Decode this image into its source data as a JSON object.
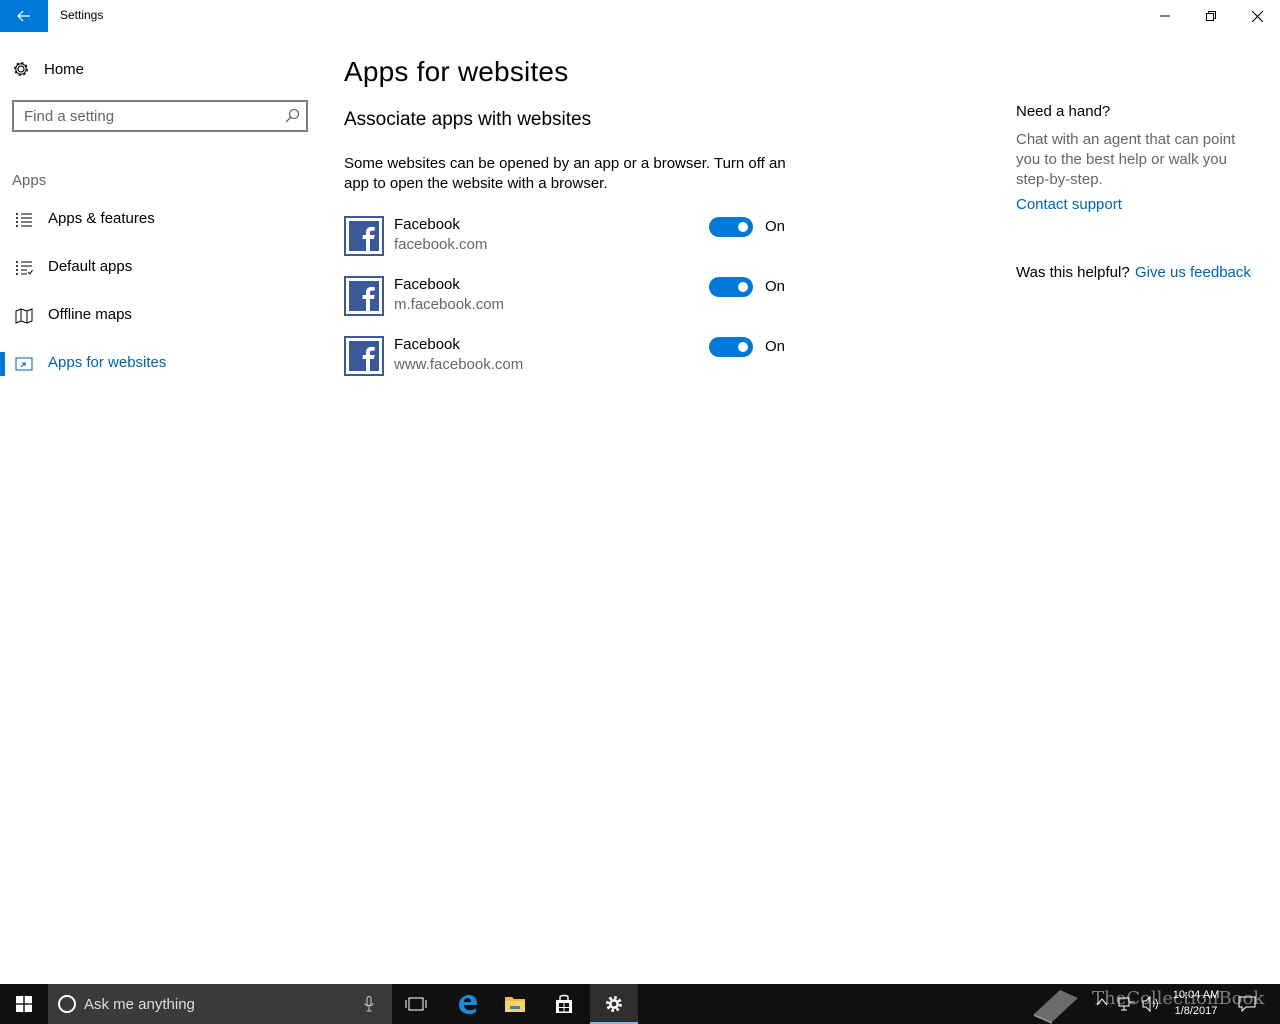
{
  "window": {
    "title": "Settings"
  },
  "sidebar": {
    "home_label": "Home",
    "search_placeholder": "Find a setting",
    "section_label": "Apps",
    "items": [
      {
        "label": "Apps & features",
        "icon": "list-icon",
        "active": false
      },
      {
        "label": "Default apps",
        "icon": "default-apps-icon",
        "active": false
      },
      {
        "label": "Offline maps",
        "icon": "map-icon",
        "active": false
      },
      {
        "label": "Apps for websites",
        "icon": "apps-websites-icon",
        "active": true
      }
    ]
  },
  "main": {
    "title": "Apps for websites",
    "subtitle": "Associate apps with websites",
    "description": "Some websites can be opened by an app or a browser.  Turn off an app to open the website with a browser.",
    "apps": [
      {
        "name": "Facebook",
        "url": "facebook.com",
        "toggle": "On",
        "enabled": true
      },
      {
        "name": "Facebook",
        "url": "m.facebook.com",
        "toggle": "On",
        "enabled": true
      },
      {
        "name": "Facebook",
        "url": "www.facebook.com",
        "toggle": "On",
        "enabled": true
      }
    ]
  },
  "help": {
    "title": "Need a hand?",
    "text": "Chat with an agent that can point you to the best help or walk you step-by-step.",
    "contact_link": "Contact support",
    "helpful_label": "Was this helpful?",
    "feedback_link": "Give us feedback"
  },
  "taskbar": {
    "search_placeholder": "Ask me anything",
    "time": "10:04 AM",
    "date": "1/8/2017",
    "watermark": "TheCollectionBook"
  },
  "colors": {
    "accent": "#0078d7",
    "link": "#0063b1",
    "facebook": "#3b5998",
    "taskbar": "#101010"
  }
}
